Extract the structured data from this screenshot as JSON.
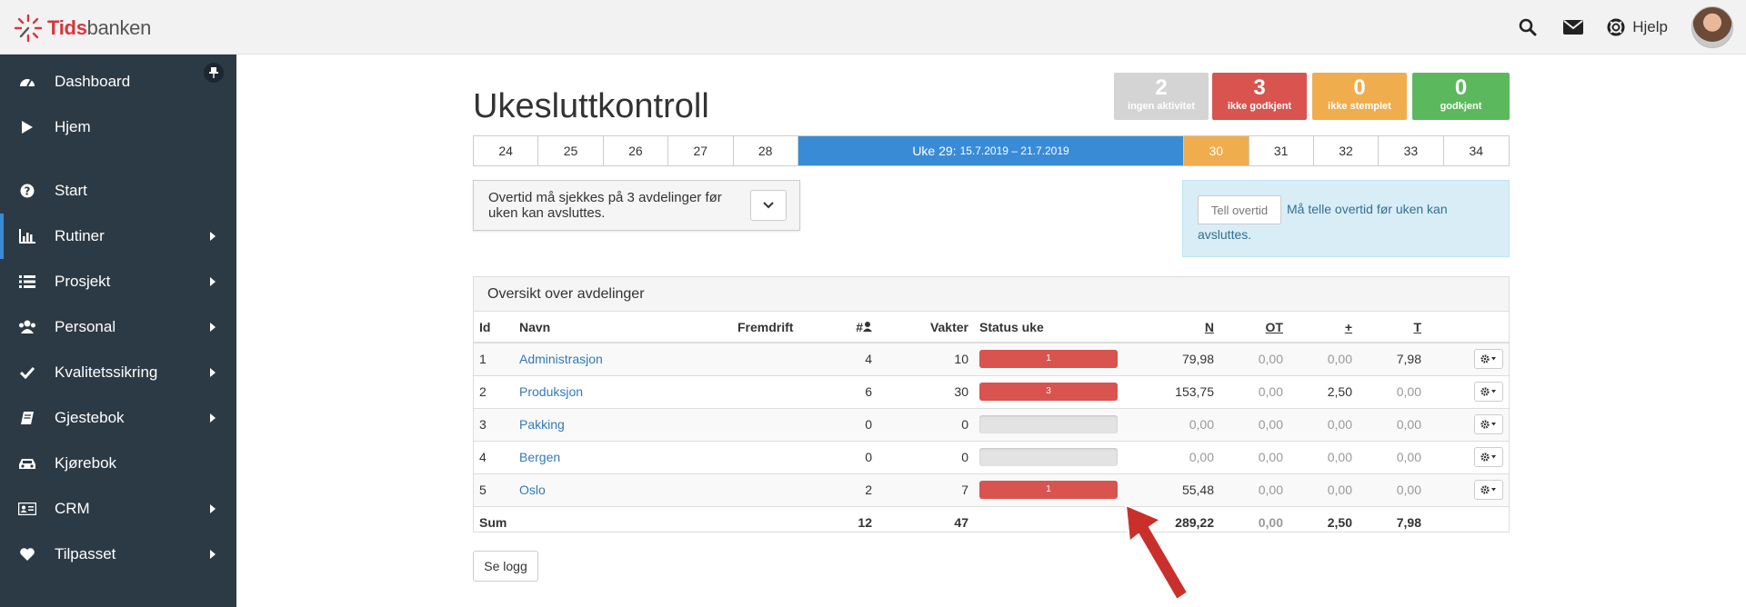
{
  "brand": {
    "strong": "Tids",
    "rest": "banken"
  },
  "topbar": {
    "help_label": "Hjelp"
  },
  "sidebar": {
    "items": [
      {
        "label": "Dashboard",
        "icon": "dashboard-icon",
        "submenu": false
      },
      {
        "label": "Hjem",
        "icon": "play-icon",
        "submenu": false
      },
      {
        "label": "Start",
        "icon": "question-icon",
        "submenu": false
      },
      {
        "label": "Rutiner",
        "icon": "bar-chart-icon",
        "submenu": true
      },
      {
        "label": "Prosjekt",
        "icon": "list-icon",
        "submenu": true
      },
      {
        "label": "Personal",
        "icon": "users-icon",
        "submenu": true
      },
      {
        "label": "Kvalitetssikring",
        "icon": "check-icon",
        "submenu": true
      },
      {
        "label": "Gjestebok",
        "icon": "book-icon",
        "submenu": true
      },
      {
        "label": "Kjørebok",
        "icon": "car-icon",
        "submenu": false
      },
      {
        "label": "CRM",
        "icon": "id-card-icon",
        "submenu": true
      },
      {
        "label": "Tilpasset",
        "icon": "heart-icon",
        "submenu": true
      }
    ]
  },
  "page": {
    "title": "Ukesluttkontroll"
  },
  "status": [
    {
      "count": "2",
      "label": "ingen aktivitet",
      "color": "#d4d4d4"
    },
    {
      "count": "3",
      "label": "ikke godkjent",
      "color": "#d9534f"
    },
    {
      "count": "0",
      "label": "ikke stemplet",
      "color": "#f0ad4e"
    },
    {
      "count": "0",
      "label": "godkjent",
      "color": "#5cb85c"
    }
  ],
  "weeks": {
    "before": [
      "24",
      "25",
      "26",
      "27",
      "28"
    ],
    "current_label": "Uke 29:",
    "current_range": "15.7.2019 – 21.7.2019",
    "highlight": "30",
    "after": [
      "31",
      "32",
      "33",
      "34"
    ]
  },
  "alert": {
    "text": "Overtid må sjekkes på 3 avdelinger før uken kan avsluttes."
  },
  "info": {
    "button": "Tell overtid",
    "text1": "Må telle overtid før uken kan",
    "text2": "avsluttes."
  },
  "panel": {
    "heading": "Oversikt over avdelinger",
    "columns": {
      "id": "Id",
      "name": "Navn",
      "progress": "Fremdrift",
      "count": "#",
      "shifts": "Vakter",
      "status": "Status uke",
      "n": "N",
      "ot": "OT",
      "plus": "+",
      "t": "T"
    },
    "rows": [
      {
        "id": "1",
        "name": "Administrasjon",
        "count": "4",
        "shifts": "10",
        "status_value": "1",
        "status_fill": 1,
        "n": "79,98",
        "ot": "0,00",
        "plus": "0,00",
        "t": "7,98"
      },
      {
        "id": "2",
        "name": "Produksjon",
        "count": "6",
        "shifts": "30",
        "status_value": "3",
        "status_fill": 1,
        "n": "153,75",
        "ot": "0,00",
        "plus": "2,50",
        "t": "0,00"
      },
      {
        "id": "3",
        "name": "Pakking",
        "count": "0",
        "shifts": "0",
        "status_value": "",
        "status_fill": 0,
        "n": "0,00",
        "ot": "0,00",
        "plus": "0,00",
        "t": "0,00"
      },
      {
        "id": "4",
        "name": "Bergen",
        "count": "0",
        "shifts": "0",
        "status_value": "",
        "status_fill": 0,
        "n": "0,00",
        "ot": "0,00",
        "plus": "0,00",
        "t": "0,00"
      },
      {
        "id": "5",
        "name": "Oslo",
        "count": "2",
        "shifts": "7",
        "status_value": "1",
        "status_fill": 1,
        "n": "55,48",
        "ot": "0,00",
        "plus": "0,00",
        "t": "0,00"
      }
    ],
    "sum": {
      "label": "Sum",
      "count": "12",
      "shifts": "47",
      "n": "289,22",
      "ot": "0,00",
      "plus": "2,50",
      "t": "7,98"
    }
  },
  "log_button": "Se logg"
}
